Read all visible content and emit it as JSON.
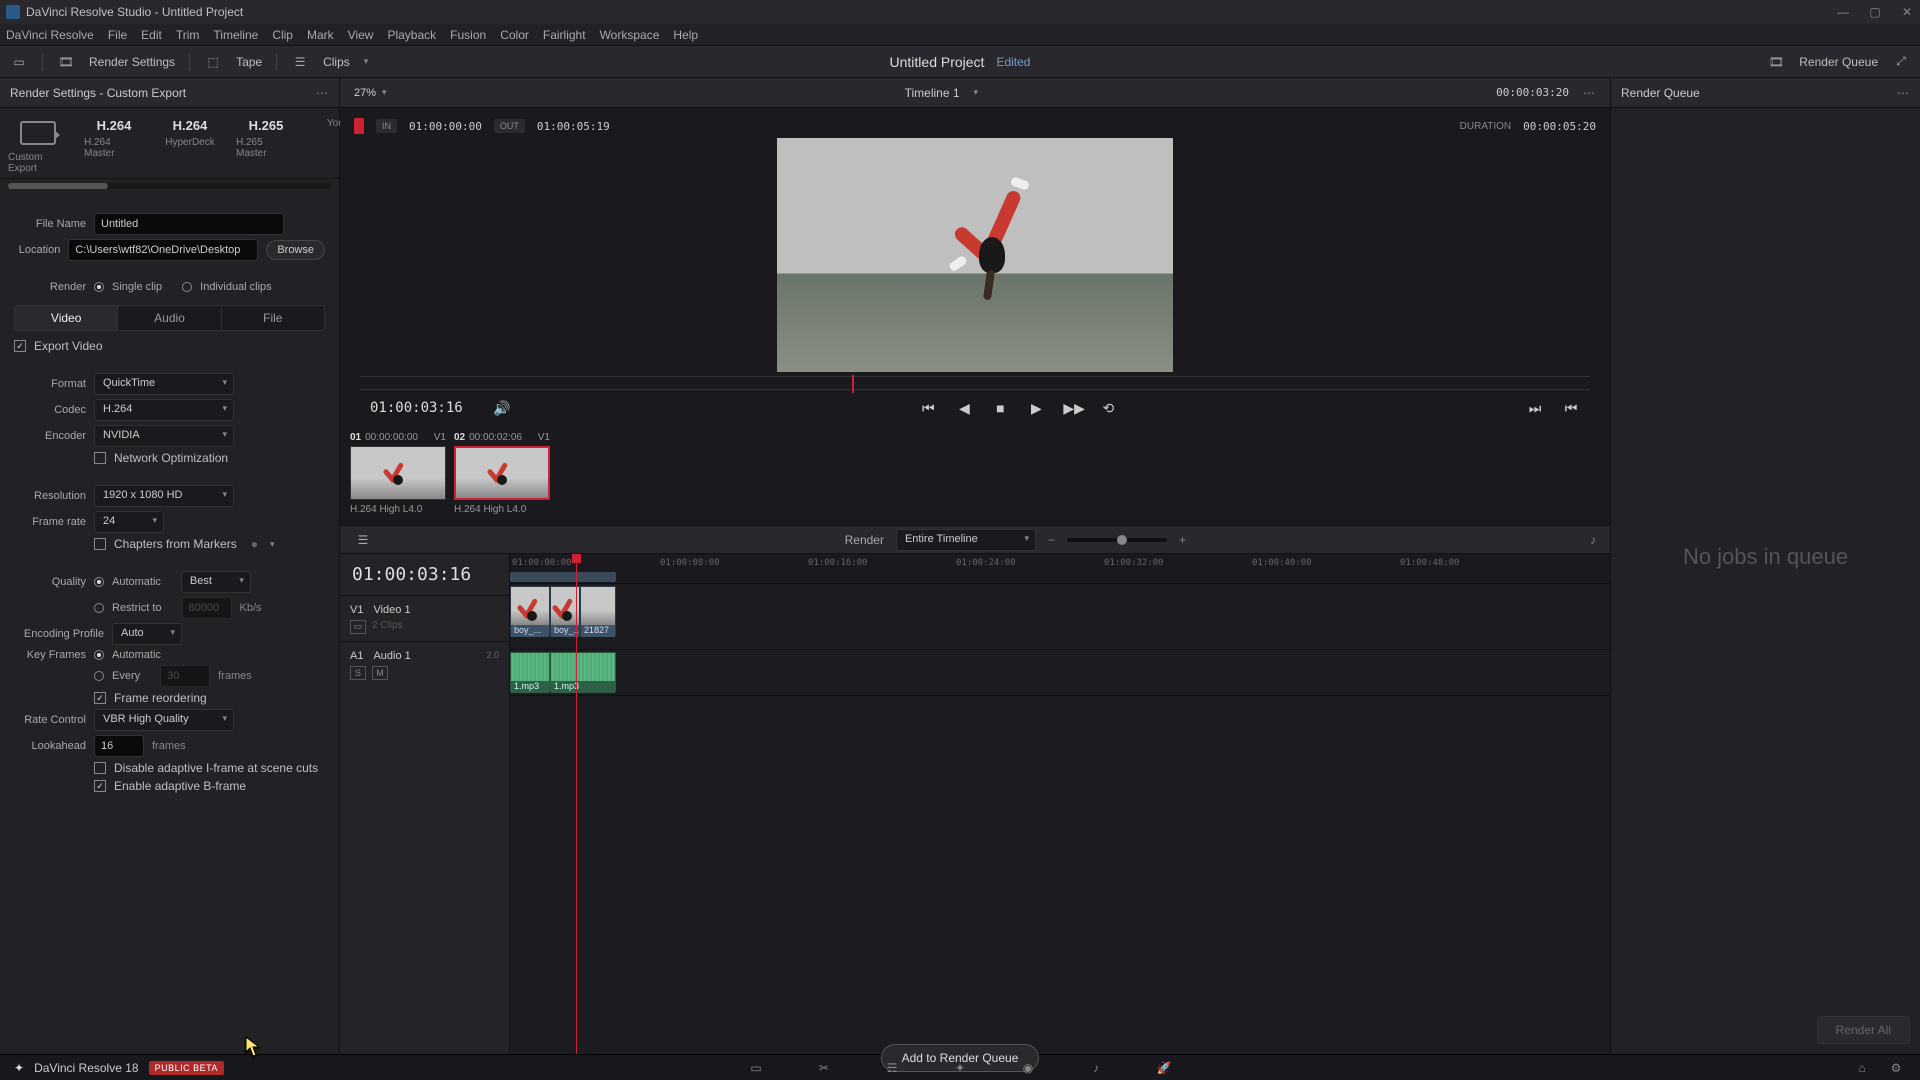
{
  "window": {
    "title": "DaVinci Resolve Studio - Untitled Project"
  },
  "menu": [
    "DaVinci Resolve",
    "File",
    "Edit",
    "Trim",
    "Timeline",
    "Clip",
    "Mark",
    "View",
    "Playback",
    "Fusion",
    "Color",
    "Fairlight",
    "Workspace",
    "Help"
  ],
  "toolbar": {
    "render_settings": "Render Settings",
    "tape": "Tape",
    "clips": "Clips",
    "project_title": "Untitled Project",
    "edited": "Edited",
    "render_queue_btn": "Render Queue"
  },
  "left": {
    "header": "Render Settings - Custom Export",
    "presets": [
      {
        "title": "",
        "sub": "Custom Export"
      },
      {
        "title": "H.264",
        "sub": "H.264 Master"
      },
      {
        "title": "H.264",
        "sub": "HyperDeck"
      },
      {
        "title": "H.265",
        "sub": "H.265 Master"
      },
      {
        "title": "",
        "sub": "YouT..."
      }
    ],
    "filename_label": "File Name",
    "filename_value": "Untitled",
    "location_label": "Location",
    "location_value": "C:\\Users\\wtf82\\OneDrive\\Desktop",
    "browse": "Browse",
    "render_label": "Render",
    "render_single": "Single clip",
    "render_individual": "Individual clips",
    "tabs": {
      "video": "Video",
      "audio": "Audio",
      "file": "File"
    },
    "export_video": "Export Video",
    "format_label": "Format",
    "format_value": "QuickTime",
    "codec_label": "Codec",
    "codec_value": "H.264",
    "encoder_label": "Encoder",
    "encoder_value": "NVIDIA",
    "netopt": "Network Optimization",
    "res_label": "Resolution",
    "res_value": "1920 x 1080 HD",
    "fps_label": "Frame rate",
    "fps_value": "24",
    "chapters": "Chapters from Markers",
    "quality_label": "Quality",
    "quality_auto": "Automatic",
    "quality_best": "Best",
    "restrict": "Restrict to",
    "restrict_val": "80000",
    "restrict_unit": "Kb/s",
    "encprof_label": "Encoding Profile",
    "encprof_value": "Auto",
    "keyframes_label": "Key Frames",
    "kf_auto": "Automatic",
    "kf_every": "Every",
    "kf_num": "30",
    "kf_unit": "frames",
    "frame_reorder": "Frame reordering",
    "rate_label": "Rate Control",
    "rate_value": "VBR High Quality",
    "look_label": "Lookahead",
    "look_val": "16",
    "look_unit": "frames",
    "disable_i": "Disable adaptive I-frame at scene cuts",
    "enable_b": "Enable adaptive B-frame",
    "add_queue": "Add to Render Queue"
  },
  "center": {
    "zoom_value": "27%",
    "timeline_name": "Timeline 1",
    "top_tc": "00:00:03:20",
    "in_label": "IN",
    "in_val": "01:00:00:00",
    "out_label": "OUT",
    "out_val": "01:00:05:19",
    "dur_label": "DURATION",
    "dur_val": "00:00:05:20",
    "play_tc": "01:00:03:16",
    "src_clips": [
      {
        "num": "01",
        "tc": "00:00:00:00",
        "trk": "V1",
        "label": "H.264 High L4.0"
      },
      {
        "num": "02",
        "tc": "00:00:02:06",
        "trk": "V1",
        "label": "H.264 High L4.0"
      }
    ],
    "tlbar_render_label": "Render",
    "tlbar_render_value": "Entire Timeline",
    "tl_bigtime": "01:00:03:16",
    "ruler_ticks": [
      "01:00:00:00",
      "01:00:08:00",
      "01:00:16:00",
      "01:00:24:00",
      "01:00:32:00",
      "01:00:40:00",
      "01:00:48:00"
    ],
    "v_track": {
      "id": "V1",
      "name": "Video 1",
      "clips_meta": "2 Clips"
    },
    "a_track": {
      "id": "A1",
      "name": "Audio 1",
      "level": "2.0"
    },
    "v_clips": [
      {
        "label": "boy_..."
      },
      {
        "label": "boy_..."
      },
      {
        "label": "21827 ..."
      }
    ],
    "a_clips": [
      {
        "label": "1.mp3"
      },
      {
        "label": "1.mp3"
      }
    ]
  },
  "right": {
    "header": "Render Queue",
    "empty": "No jobs in queue",
    "render_all": "Render All"
  },
  "bottom": {
    "ver": "DaVinci Resolve 18",
    "badge": "PUBLIC BETA"
  }
}
